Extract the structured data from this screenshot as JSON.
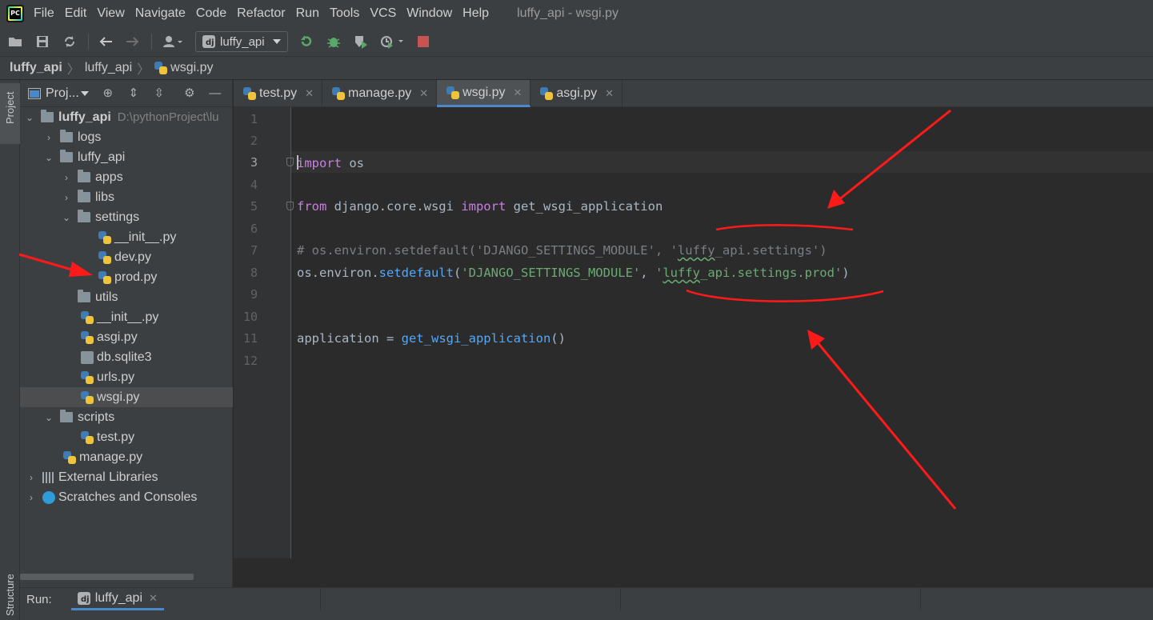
{
  "menubar": {
    "items": [
      "File",
      "Edit",
      "View",
      "Navigate",
      "Code",
      "Refactor",
      "Run",
      "Tools",
      "VCS",
      "Window",
      "Help"
    ],
    "window_title": "luffy_api - wsgi.py"
  },
  "toolbar": {
    "run_config_label": "luffy_api"
  },
  "breadcrumb": {
    "items": [
      "luffy_api",
      "luffy_api",
      "wsgi.py"
    ]
  },
  "side_stripe": {
    "project_label": "Project",
    "structure_label": "Structure"
  },
  "project_panel": {
    "title": "Proj...",
    "rows": [
      {
        "label": "luffy_api",
        "hint": "D:\\pythonProject\\lu"
      },
      {
        "label": "logs"
      },
      {
        "label": "luffy_api"
      },
      {
        "label": "apps"
      },
      {
        "label": "libs"
      },
      {
        "label": "settings"
      },
      {
        "label": "__init__.py"
      },
      {
        "label": "dev.py"
      },
      {
        "label": "prod.py"
      },
      {
        "label": "utils"
      },
      {
        "label": "__init__.py"
      },
      {
        "label": "asgi.py"
      },
      {
        "label": "db.sqlite3"
      },
      {
        "label": "urls.py"
      },
      {
        "label": "wsgi.py"
      },
      {
        "label": "scripts"
      },
      {
        "label": "test.py"
      },
      {
        "label": "manage.py"
      },
      {
        "label": "External Libraries"
      },
      {
        "label": "Scratches and Consoles"
      }
    ]
  },
  "editor": {
    "tabs": [
      {
        "label": "test.py"
      },
      {
        "label": "manage.py"
      },
      {
        "label": "wsgi.py"
      },
      {
        "label": "asgi.py"
      }
    ],
    "line_numbers": [
      "1",
      "2",
      "3",
      "4",
      "5",
      "6",
      "7",
      "8",
      "9",
      "10",
      "11",
      "12"
    ],
    "code": {
      "l3_kw": "import",
      "l3_rest": " os",
      "l5_kw1": "from",
      "l5_mid": " django.core.wsgi ",
      "l5_kw2": "import",
      "l5_rest": " get_wsgi_application",
      "l7_comment_a": "# os.environ.setdefault('DJANGO_SETTINGS_MODULE', '",
      "l7_comment_b": "luffy",
      "l7_comment_c": "_api.settings')",
      "l8_a": "os.environ.",
      "l8_fn": "setdefault",
      "l8_b": "(",
      "l8_str1": "'DJANGO_SETTINGS_MODULE'",
      "l8_c": ", ",
      "l8_str2a": "'",
      "l8_str2b": "luffy",
      "l8_str2c": "_api.settings.prod'",
      "l8_d": ")",
      "l11_a": "application = ",
      "l11_fn": "get_wsgi_application",
      "l11_b": "()"
    }
  },
  "run_panel": {
    "label": "Run:",
    "tab_label": "luffy_api"
  },
  "colors": {
    "keyword": "#cc7ee5",
    "function": "#56a8f5",
    "string": "#6aab73",
    "comment": "#7a7e85",
    "annotation_red": "#ff1a1a",
    "accent_blue": "#4a88c7"
  }
}
